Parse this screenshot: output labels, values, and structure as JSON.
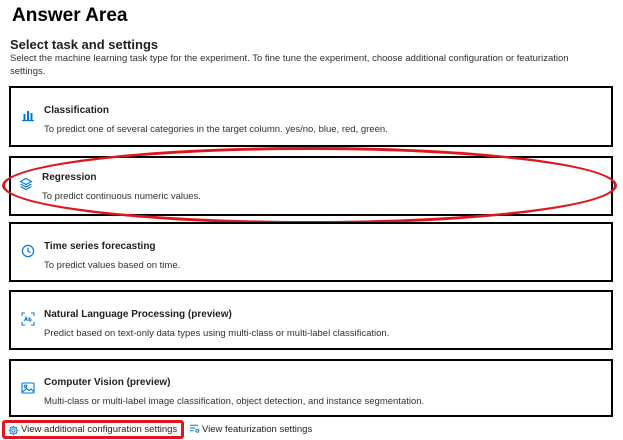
{
  "header": {
    "answer_area": "Answer Area",
    "section_title": "Select task and settings",
    "section_description": "Select the machine learning task type for the experiment. To fine tune the experiment, choose additional configuration or featurization settings."
  },
  "tasks": [
    {
      "id": "classification",
      "icon": "bar-chart-icon",
      "title": "Classification",
      "description": "To predict one of several categories in the target column. yes/no, blue, red, green.",
      "highlighted": false
    },
    {
      "id": "regression",
      "icon": "layers-icon",
      "title": "Regression",
      "description": "To predict continuous numeric values.",
      "highlighted": true
    },
    {
      "id": "timeseries",
      "icon": "clock-icon",
      "title": "Time series forecasting",
      "description": "To predict values based on time.",
      "highlighted": false
    },
    {
      "id": "nlp",
      "icon": "text-scan-icon",
      "title": "Natural Language Processing (preview)",
      "description": "Predict based on text-only data types using multi-class or multi-label classification.",
      "highlighted": false
    },
    {
      "id": "vision",
      "icon": "image-icon",
      "title": "Computer Vision (preview)",
      "description": "Multi-class or multi-label image classification, object detection, and instance segmentation.",
      "highlighted": false
    }
  ],
  "links": {
    "config": {
      "label": "View additional configuration settings",
      "icon": "gear-icon",
      "highlighted": true
    },
    "featurization": {
      "label": "View featurization settings",
      "icon": "list-settings-icon"
    }
  },
  "colors": {
    "accent": "#0078d4",
    "highlight": "#e0161d",
    "border": "#000000"
  }
}
